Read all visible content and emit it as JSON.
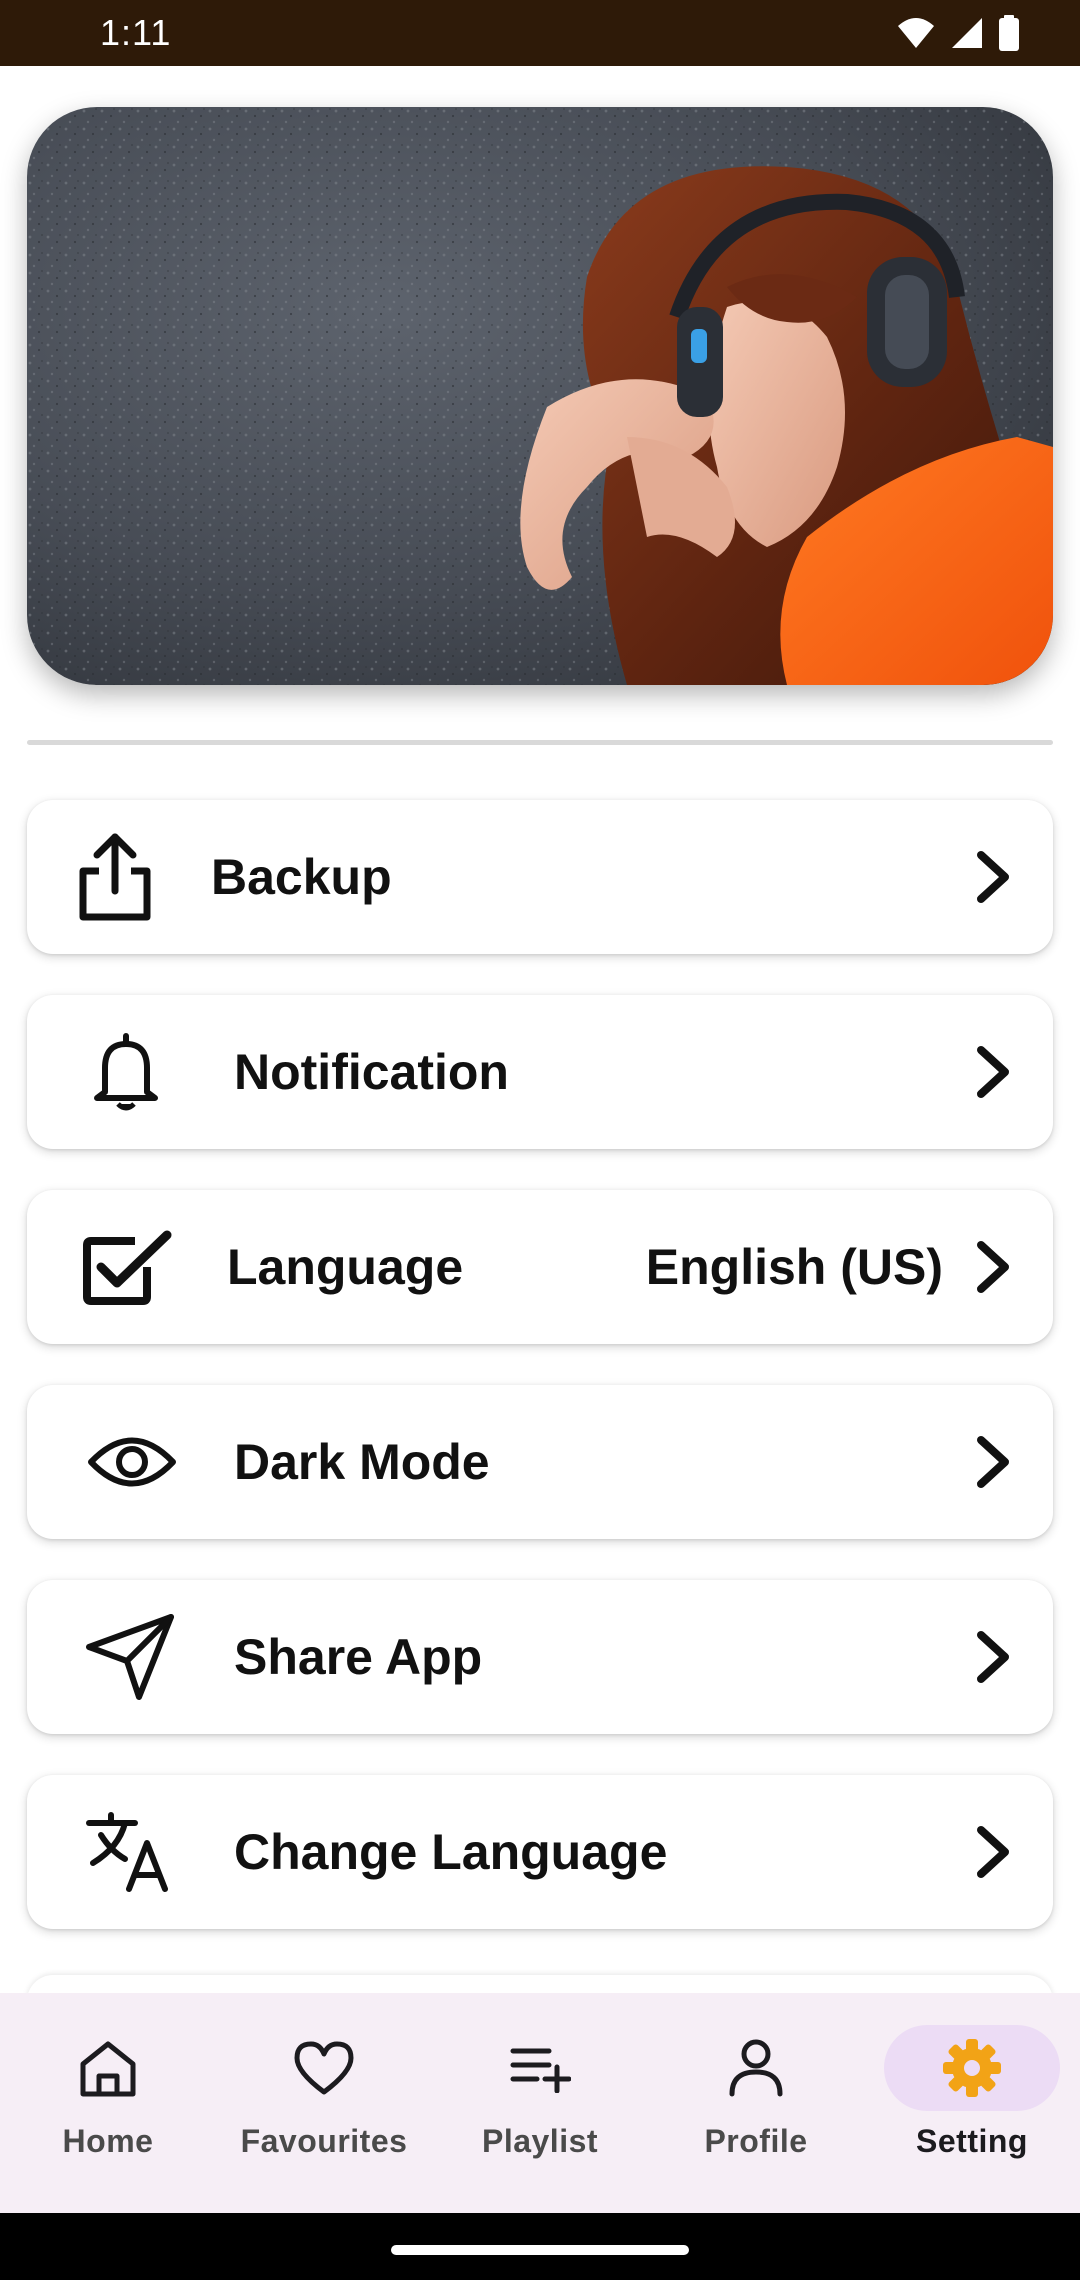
{
  "status_bar": {
    "time": "1:11",
    "icons": [
      "wifi-icon",
      "cellular-signal-icon",
      "battery-icon"
    ]
  },
  "hero": {
    "image": "woman-with-headphones-banner",
    "colors": {
      "background": "#4a4f58",
      "shirt": "#ff6a1a",
      "hair": "#6b2a14"
    }
  },
  "settings": {
    "items": [
      {
        "id": "backup",
        "label": "Backup",
        "icon": "share-upload-icon"
      },
      {
        "id": "notification",
        "label": "Notification",
        "icon": "bell-icon"
      },
      {
        "id": "language",
        "label": "Language",
        "value": "English (US)",
        "icon": "checkbox-icon"
      },
      {
        "id": "dark-mode",
        "label": "Dark Mode",
        "icon": "eye-icon"
      },
      {
        "id": "share-app",
        "label": "Share App",
        "icon": "send-icon"
      },
      {
        "id": "change-language",
        "label": "Change Language",
        "icon": "translate-icon"
      }
    ]
  },
  "bottom_nav": {
    "items": [
      {
        "label": "Home",
        "icon": "home-icon",
        "active": false
      },
      {
        "label": "Favourites",
        "icon": "heart-icon",
        "active": false
      },
      {
        "label": "Playlist",
        "icon": "playlist-add-icon",
        "active": false
      },
      {
        "label": "Profile",
        "icon": "person-icon",
        "active": false
      },
      {
        "label": "Setting",
        "icon": "gear-icon",
        "active": true
      }
    ],
    "active_color": "#f2a316",
    "active_pill_color": "#ecdcf5"
  }
}
